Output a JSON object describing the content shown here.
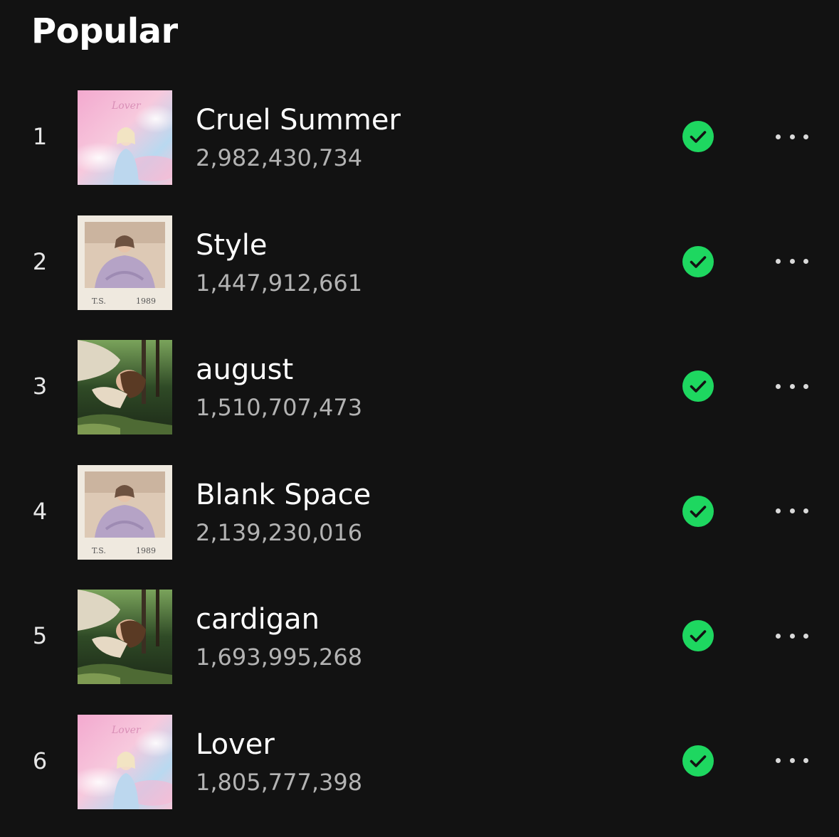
{
  "section": {
    "title": "Popular"
  },
  "tracks": [
    {
      "rank": "1",
      "title": "Cruel Summer",
      "plays": "2,982,430,734",
      "album_art": "lover-cover",
      "saved": true
    },
    {
      "rank": "2",
      "title": "Style",
      "plays": "1,447,912,661",
      "album_art": "1989-cover",
      "saved": true
    },
    {
      "rank": "3",
      "title": "august",
      "plays": "1,510,707,473",
      "album_art": "folklore-cover",
      "saved": true
    },
    {
      "rank": "4",
      "title": "Blank Space",
      "plays": "2,139,230,016",
      "album_art": "1989-cover",
      "saved": true
    },
    {
      "rank": "5",
      "title": "cardigan",
      "plays": "1,693,995,268",
      "album_art": "folklore-cover",
      "saved": true
    },
    {
      "rank": "6",
      "title": "Lover",
      "plays": "1,805,777,398",
      "album_art": "lover-cover",
      "saved": true
    }
  ],
  "icons": {
    "saved": "check-circle-icon",
    "more": "more-options-icon"
  },
  "colors": {
    "background": "#121212",
    "accent": "#1ed760",
    "primary_text": "#ffffff",
    "secondary_text": "#b3b3b3"
  }
}
